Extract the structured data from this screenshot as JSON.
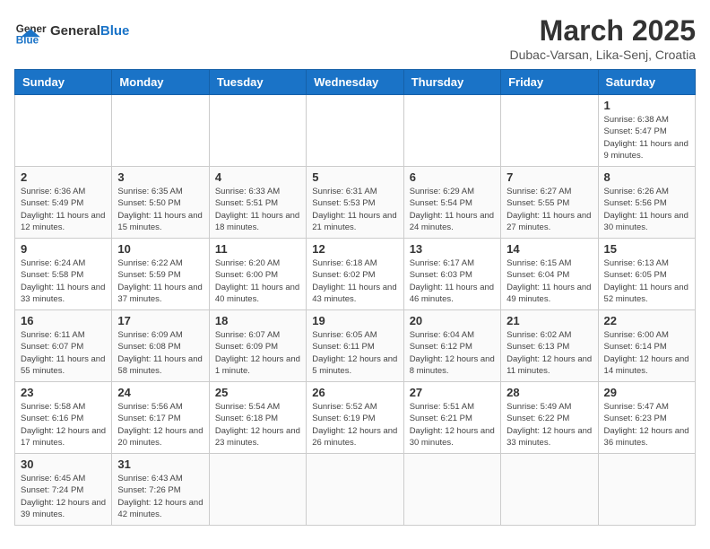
{
  "header": {
    "logo_general": "General",
    "logo_blue": "Blue",
    "month_title": "March 2025",
    "subtitle": "Dubac-Varsan, Lika-Senj, Croatia"
  },
  "days_of_week": [
    "Sunday",
    "Monday",
    "Tuesday",
    "Wednesday",
    "Thursday",
    "Friday",
    "Saturday"
  ],
  "weeks": [
    [
      {
        "day": "",
        "info": ""
      },
      {
        "day": "",
        "info": ""
      },
      {
        "day": "",
        "info": ""
      },
      {
        "day": "",
        "info": ""
      },
      {
        "day": "",
        "info": ""
      },
      {
        "day": "",
        "info": ""
      },
      {
        "day": "1",
        "info": "Sunrise: 6:38 AM\nSunset: 5:47 PM\nDaylight: 11 hours and 9 minutes."
      }
    ],
    [
      {
        "day": "2",
        "info": "Sunrise: 6:36 AM\nSunset: 5:49 PM\nDaylight: 11 hours and 12 minutes."
      },
      {
        "day": "3",
        "info": "Sunrise: 6:35 AM\nSunset: 5:50 PM\nDaylight: 11 hours and 15 minutes."
      },
      {
        "day": "4",
        "info": "Sunrise: 6:33 AM\nSunset: 5:51 PM\nDaylight: 11 hours and 18 minutes."
      },
      {
        "day": "5",
        "info": "Sunrise: 6:31 AM\nSunset: 5:53 PM\nDaylight: 11 hours and 21 minutes."
      },
      {
        "day": "6",
        "info": "Sunrise: 6:29 AM\nSunset: 5:54 PM\nDaylight: 11 hours and 24 minutes."
      },
      {
        "day": "7",
        "info": "Sunrise: 6:27 AM\nSunset: 5:55 PM\nDaylight: 11 hours and 27 minutes."
      },
      {
        "day": "8",
        "info": "Sunrise: 6:26 AM\nSunset: 5:56 PM\nDaylight: 11 hours and 30 minutes."
      }
    ],
    [
      {
        "day": "9",
        "info": "Sunrise: 6:24 AM\nSunset: 5:58 PM\nDaylight: 11 hours and 33 minutes."
      },
      {
        "day": "10",
        "info": "Sunrise: 6:22 AM\nSunset: 5:59 PM\nDaylight: 11 hours and 37 minutes."
      },
      {
        "day": "11",
        "info": "Sunrise: 6:20 AM\nSunset: 6:00 PM\nDaylight: 11 hours and 40 minutes."
      },
      {
        "day": "12",
        "info": "Sunrise: 6:18 AM\nSunset: 6:02 PM\nDaylight: 11 hours and 43 minutes."
      },
      {
        "day": "13",
        "info": "Sunrise: 6:17 AM\nSunset: 6:03 PM\nDaylight: 11 hours and 46 minutes."
      },
      {
        "day": "14",
        "info": "Sunrise: 6:15 AM\nSunset: 6:04 PM\nDaylight: 11 hours and 49 minutes."
      },
      {
        "day": "15",
        "info": "Sunrise: 6:13 AM\nSunset: 6:05 PM\nDaylight: 11 hours and 52 minutes."
      }
    ],
    [
      {
        "day": "16",
        "info": "Sunrise: 6:11 AM\nSunset: 6:07 PM\nDaylight: 11 hours and 55 minutes."
      },
      {
        "day": "17",
        "info": "Sunrise: 6:09 AM\nSunset: 6:08 PM\nDaylight: 11 hours and 58 minutes."
      },
      {
        "day": "18",
        "info": "Sunrise: 6:07 AM\nSunset: 6:09 PM\nDaylight: 12 hours and 1 minute."
      },
      {
        "day": "19",
        "info": "Sunrise: 6:05 AM\nSunset: 6:11 PM\nDaylight: 12 hours and 5 minutes."
      },
      {
        "day": "20",
        "info": "Sunrise: 6:04 AM\nSunset: 6:12 PM\nDaylight: 12 hours and 8 minutes."
      },
      {
        "day": "21",
        "info": "Sunrise: 6:02 AM\nSunset: 6:13 PM\nDaylight: 12 hours and 11 minutes."
      },
      {
        "day": "22",
        "info": "Sunrise: 6:00 AM\nSunset: 6:14 PM\nDaylight: 12 hours and 14 minutes."
      }
    ],
    [
      {
        "day": "23",
        "info": "Sunrise: 5:58 AM\nSunset: 6:16 PM\nDaylight: 12 hours and 17 minutes."
      },
      {
        "day": "24",
        "info": "Sunrise: 5:56 AM\nSunset: 6:17 PM\nDaylight: 12 hours and 20 minutes."
      },
      {
        "day": "25",
        "info": "Sunrise: 5:54 AM\nSunset: 6:18 PM\nDaylight: 12 hours and 23 minutes."
      },
      {
        "day": "26",
        "info": "Sunrise: 5:52 AM\nSunset: 6:19 PM\nDaylight: 12 hours and 26 minutes."
      },
      {
        "day": "27",
        "info": "Sunrise: 5:51 AM\nSunset: 6:21 PM\nDaylight: 12 hours and 30 minutes."
      },
      {
        "day": "28",
        "info": "Sunrise: 5:49 AM\nSunset: 6:22 PM\nDaylight: 12 hours and 33 minutes."
      },
      {
        "day": "29",
        "info": "Sunrise: 5:47 AM\nSunset: 6:23 PM\nDaylight: 12 hours and 36 minutes."
      }
    ],
    [
      {
        "day": "30",
        "info": "Sunrise: 6:45 AM\nSunset: 7:24 PM\nDaylight: 12 hours and 39 minutes."
      },
      {
        "day": "31",
        "info": "Sunrise: 6:43 AM\nSunset: 7:26 PM\nDaylight: 12 hours and 42 minutes."
      },
      {
        "day": "",
        "info": ""
      },
      {
        "day": "",
        "info": ""
      },
      {
        "day": "",
        "info": ""
      },
      {
        "day": "",
        "info": ""
      },
      {
        "day": "",
        "info": ""
      }
    ]
  ]
}
